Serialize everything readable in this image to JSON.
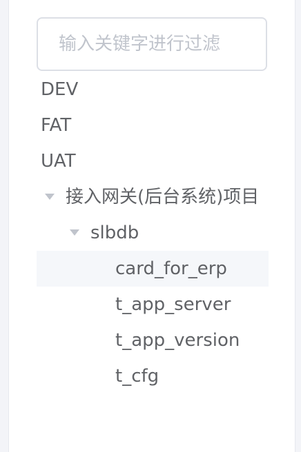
{
  "filter": {
    "placeholder": "输入关键字进行过滤",
    "value": ""
  },
  "tree": {
    "env_dev": "DEV",
    "env_fat": "FAT",
    "env_uat": "UAT",
    "project": "接入网关(后台系统)项目",
    "database": "slbdb",
    "tables": [
      "card_for_erp",
      "t_app_server",
      "t_app_version",
      "t_cfg"
    ],
    "selected_table": "card_for_erp"
  },
  "colors": {
    "text": "#606266",
    "placeholder": "#c0c4cc",
    "selected_bg": "#f5f7fa",
    "border": "#dcdfe6"
  }
}
